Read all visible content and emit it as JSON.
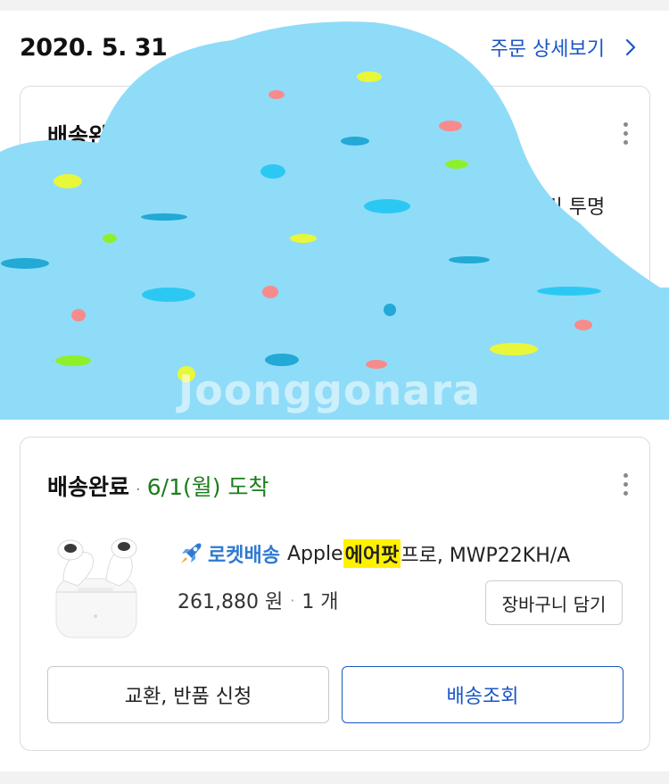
{
  "order": {
    "date": "2020. 5. 31",
    "detail_link": "주문 상세보기"
  },
  "card1": {
    "status": "배송완료",
    "product_fragment": "스 키링 투명"
  },
  "card2": {
    "status": "배송완료",
    "arrival": "6/1(월) 도착",
    "product": {
      "badge": "로켓배송",
      "title_pre": "Apple ",
      "title_highlight": "에어팟",
      "title_post": " 프로, MWP22KH/A",
      "price": "261,880 원",
      "quantity": "1 개"
    },
    "cart_button": "장바구니 담기",
    "exchange_button": "교환, 반품 신청",
    "track_button": "배송조회"
  },
  "watermark": "Joonggonara",
  "colors": {
    "link_blue": "#1a56c4",
    "arrival_green": "#1b7d1b",
    "rocket_blue": "#2f7ad2",
    "highlight_yellow": "#fff200",
    "cloud_blue": "#8fdcf8"
  },
  "icons": [
    "chevron-right-icon",
    "more-vertical-icon",
    "rocket-icon",
    "airpods-pro-image"
  ]
}
